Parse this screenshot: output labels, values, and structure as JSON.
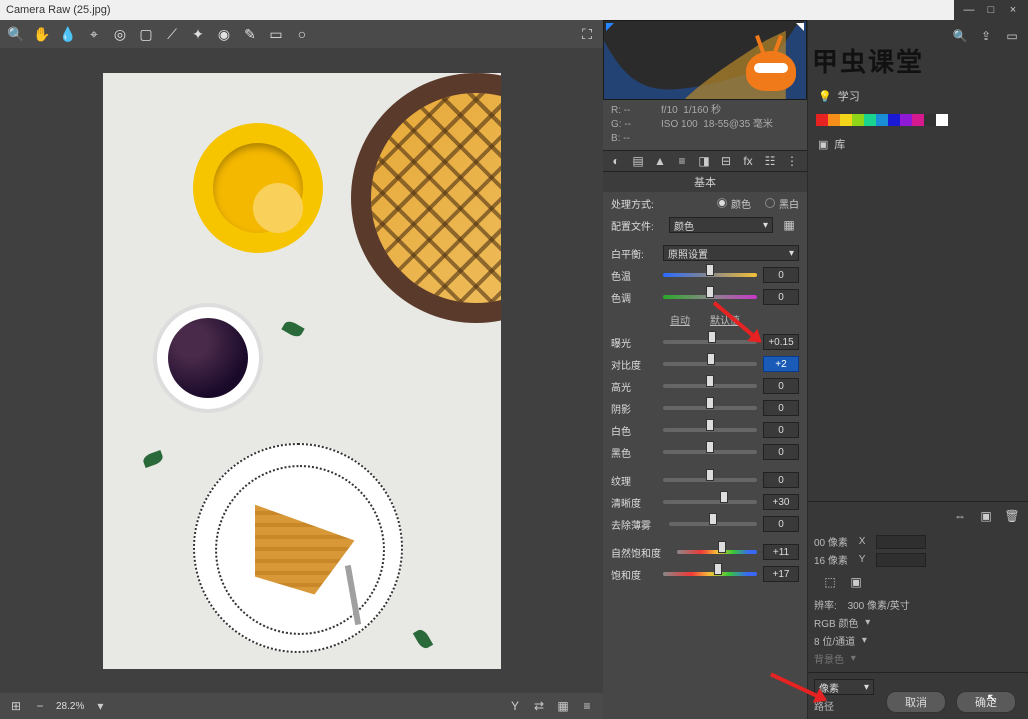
{
  "window": {
    "title": "Camera Raw (25.jpg)"
  },
  "logo": {
    "text": "甲虫课堂"
  },
  "toolbar": {
    "tools": [
      "zoom",
      "hand",
      "wb-eyedropper",
      "color-sampler",
      "target",
      "crop",
      "straighten",
      "spot",
      "redeye",
      "adjust-brush",
      "grad-filter",
      "radial-filter",
      "rotate-ccw",
      "prefs"
    ]
  },
  "meta": {
    "R": "--",
    "G": "--",
    "B": "--",
    "aperture": "f/10",
    "shutter": "1/160 秒",
    "iso": "ISO 100",
    "lens": "18-55@35 毫米"
  },
  "panel": {
    "title": "基本",
    "process_label": "处理方式:",
    "process_color": "颜色",
    "process_bw": "黑白",
    "profile_label": "配置文件:",
    "profile_value": "颜色",
    "wb_label": "白平衡:",
    "wb_value": "原照设置",
    "temp_label": "色温",
    "temp_value": "0",
    "tint_label": "色调",
    "tint_value": "0",
    "auto": "自动",
    "default": "默认值",
    "exposure_label": "曝光",
    "exposure_value": "+0.15",
    "contrast_label": "对比度",
    "contrast_value": "+2",
    "highlights_label": "高光",
    "highlights_value": "0",
    "shadows_label": "阴影",
    "shadows_value": "0",
    "whites_label": "白色",
    "whites_value": "0",
    "blacks_label": "黑色",
    "blacks_value": "0",
    "texture_label": "纹理",
    "texture_value": "0",
    "clarity_label": "清晰度",
    "clarity_value": "+30",
    "dehaze_label": "去除薄雾",
    "dehaze_value": "0",
    "vibrance_label": "自然饱和度",
    "vibrance_value": "+11",
    "saturation_label": "饱和度",
    "saturation_value": "+17"
  },
  "zoom": {
    "level": "28.2%"
  },
  "footer": {
    "cancel": "取消",
    "ok": "确定"
  },
  "far": {
    "learn": "学习",
    "library": "库",
    "paths": "路径",
    "res_label": "辨率:",
    "res_value": "300 像素/英寸",
    "mode_value": "RGB 颜色",
    "depth_value": "8 位/通道",
    "bg_value": "背景色",
    "px_suffix": "像素",
    "w_suffix": "00 像素",
    "h_suffix": "16 像素",
    "X": "X",
    "Y": "Y"
  },
  "swatch_colors": [
    "#e62222",
    "#f58f1a",
    "#f5d51a",
    "#8fd51a",
    "#1ad58f",
    "#1a8fd5",
    "#1a1ad5",
    "#8f1ad5",
    "#d51a8f",
    "#333333",
    "#ffffff"
  ]
}
